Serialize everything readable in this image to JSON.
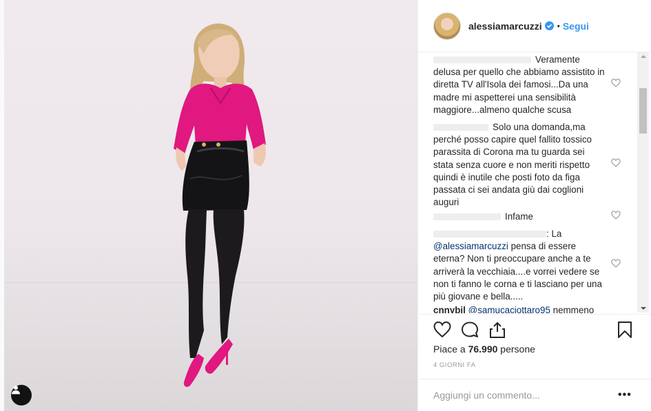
{
  "post": {
    "username": "alessiamarcuzzi",
    "verified": true,
    "separator": "•",
    "follow_label": "Segui",
    "likes_prefix": "Piace a ",
    "likes_count": "76.990",
    "likes_suffix": " persone",
    "date": "4 GIORNI FA",
    "comment_placeholder": "Aggiungi un commento...",
    "more_label": "•••"
  },
  "comments": [
    {
      "text": "Veramente delusa per quello che abbiamo assistito in diretta TV all'Isola dei famosi...Da una madre mi aspetterei una sensibilità maggiore...almeno qualche scusa"
    },
    {
      "text": "Solo una domanda,ma perché posso capire quel fallito tossico parassita di Corona ma tu guarda sei stata senza cuore e non meriti rispetto quindi è inutile che posti foto da figa passata ci sei andata giù dai coglioni auguri"
    },
    {
      "text": "Infame"
    },
    {
      "text_prefix": ": La",
      "mention": "@alessiamarcuzzi",
      "text": " pensa di essere eterna? Non ti preoccupare anche a te arriverà la vecchiaia....e vorrei vedere se non ti fanno le corna e ti lasciano per una più giovane e bella....."
    },
    {
      "username": "cnnybil",
      "mention": "@samucaciottaro95",
      "text": " nemmeno"
    }
  ],
  "icons": {
    "like": "heart-outline-icon",
    "comment": "comment-bubble-icon",
    "share": "share-upload-icon",
    "save": "bookmark-icon",
    "comment_like": "small-heart-icon",
    "user_tag": "user-tag-icon"
  },
  "colors": {
    "accent": "#3897f0",
    "text": "#262626",
    "muted": "#999999",
    "mention": "#003569"
  }
}
